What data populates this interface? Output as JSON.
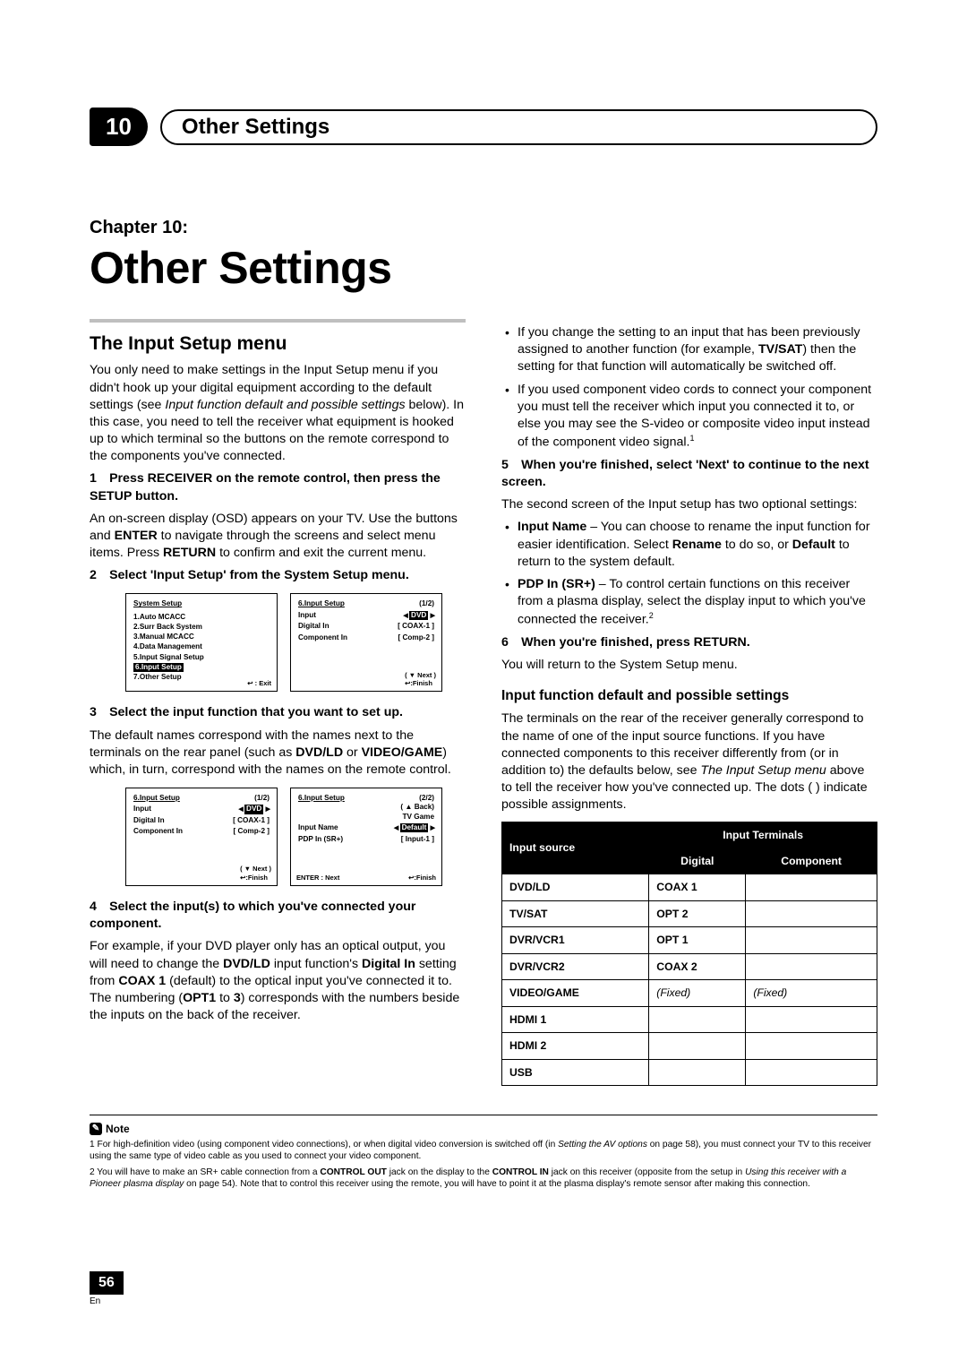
{
  "header": {
    "chapter_num": "10",
    "tab_title": "Other Settings",
    "chapter_label": "Chapter 10:",
    "page_title": "Other Settings"
  },
  "left": {
    "sec1_title": "The Input Setup menu",
    "sec1_p1a": "You only need to make settings in the Input Setup menu if you didn't hook up your digital equipment according to the default settings (see ",
    "sec1_p1b_it": "Input function default and possible settings",
    "sec1_p1c": " below). In this case, you need to tell the receiver what equipment is hooked up to which terminal so the buttons on the remote correspond to the components you've connected.",
    "step1_title": "1 Press RECEIVER on the remote control, then press the SETUP button.",
    "step1_p1a": "An on-screen display (OSD) appears on your TV. Use the ",
    "step1_p1b": " buttons and ",
    "step1_p1c_b": "ENTER",
    "step1_p1d": " to navigate through the screens and select menu items. Press ",
    "step1_p1e_b": "RETURN",
    "step1_p1f": " to confirm and exit the current menu.",
    "step2_title": "2 Select 'Input Setup' from the System Setup menu.",
    "osdA": {
      "title": "System  Setup",
      "items": [
        "1.Auto  MCACC",
        "2.Surr  Back  System",
        "3.Manual  MCACC",
        "4.Data  Management",
        "5.Input  Signal  Setup"
      ],
      "hl": "6.Input  Setup",
      "after": "7.Other  Setup",
      "foot_icon": "↩",
      "foot": " :  Exit"
    },
    "osdB": {
      "title": "6.Input  Setup",
      "count": "(1/2)",
      "row1_l": "Input",
      "row1_r": "DVD",
      "row2_l": "Digital  In",
      "row2_r": "[  COAX-1   ]",
      "row3_l": "Component In",
      "row3_r": "[  Comp-2   ]",
      "foot_center": "( ▼ Next )",
      "foot_r": "↩:Finish"
    },
    "step3_title": "3 Select the input function that you want to set up.",
    "step3_p1a": "The default names correspond with the names next to the terminals on the rear panel (such as ",
    "step3_p1b_b": "DVD/LD",
    "step3_p1c": " or ",
    "step3_p1d_b": "VIDEO/GAME",
    "step3_p1e": ") which, in turn, correspond with the names on the remote control.",
    "osdC": {
      "title": "6.Input  Setup",
      "count": "(1/2)",
      "row1_l": "Input",
      "row1_r": "DVD",
      "row2_l": "Digital  In",
      "row2_r": "[  COAX-1   ]",
      "row3_l": "Component In",
      "row3_r": "[  Comp-2   ]",
      "foot_center": "( ▼ Next )",
      "foot_r": "↩:Finish"
    },
    "osdD": {
      "title": "6.Input  Setup",
      "count": "(2/2)",
      "back": "( ▲ Back)",
      "row0": "TV Game",
      "row1_l": "Input  Name",
      "row1_r": "Default",
      "row2_l": "PDP  In  (SR+)",
      "row2_r": "[   Input-1   ]",
      "foot_l": "ENTER : Next",
      "foot_r": "↩:Finish"
    },
    "step4_title": "4 Select the input(s) to which you've connected your component.",
    "step4_p1a": "For example, if your DVD player only has an optical output, you will need to change the ",
    "step4_p1b_b": "DVD/LD",
    "step4_p1c": " input function's ",
    "step4_p1d_b": "Digital In",
    "step4_p1e": " setting from ",
    "step4_p1f_b": "COAX 1",
    "step4_p1g": " (default) to the optical input you've connected it to. The numbering (",
    "step4_p1h_b": "OPT1",
    "step4_p1i": " to ",
    "step4_p1j_b": "3",
    "step4_p1k": ") corresponds with the numbers beside the inputs on the back of the receiver."
  },
  "right": {
    "b1a": "If you change the setting to an input that has been previously assigned to another function (for example, ",
    "b1b_b": "TV/SAT",
    "b1c": ") then the setting for that function will automatically be switched off.",
    "b2": "If you used component video cords to connect your component you must tell the receiver which input you connected it to, or else you may see the S-video or composite video input instead of the component video signal.",
    "b2_sup": "1",
    "step5_title": "5 When you're finished, select 'Next' to continue to the next screen.",
    "step5_p1": "The second screen of the Input setup has two optional settings:",
    "b3a_b": "Input Name",
    "b3a": " – You can choose to rename the input function for easier identification. Select ",
    "b3b_b": "Rename",
    "b3c": " to do so, or ",
    "b3d_b": "Default",
    "b3e": " to return to the system default.",
    "b4a_b": "PDP In (SR+)",
    "b4a": " – To control certain functions on this receiver from a plasma display, select the display input to which you've connected the receiver.",
    "b4_sup": "2",
    "step6_title": "6 When you're finished, press RETURN.",
    "step6_p1": "You will return to the System Setup menu.",
    "h3": "Input function default and possible settings",
    "h3_p1a": "The terminals on the rear of the receiver generally correspond to the name of one of the input source functions. If you have connected components to this receiver differently from (or in addition to) the defaults below, see ",
    "h3_p1b_it": "The Input Setup menu",
    "h3_p1c": " above to tell the receiver how you've connected up. The dots (   ) indicate possible assignments.",
    "table": {
      "head_src": "Input source",
      "head_terms": "Input Terminals",
      "head_dig": "Digital",
      "head_comp": "Component",
      "rows": [
        {
          "src": "DVD/LD",
          "dig": "COAX 1",
          "comp": ""
        },
        {
          "src": "TV/SAT",
          "dig": "OPT 2",
          "comp": ""
        },
        {
          "src": "DVR/VCR1",
          "dig": "OPT 1",
          "comp": ""
        },
        {
          "src": "DVR/VCR2",
          "dig": "COAX 2",
          "comp": ""
        },
        {
          "src": "VIDEO/GAME",
          "dig": "(Fixed)",
          "comp": "(Fixed)",
          "italic": true
        },
        {
          "src": "HDMI 1",
          "dig": "",
          "comp": ""
        },
        {
          "src": "HDMI 2",
          "dig": "",
          "comp": ""
        },
        {
          "src": "USB",
          "dig": "",
          "comp": ""
        }
      ]
    }
  },
  "footnotes": {
    "tag": "Note",
    "f1a": "1  For high-definition video (using component video connections), or when digital video conversion is switched off (in ",
    "f1b_it": "Setting the AV options",
    "f1c": " on page 58), you must connect your TV to this receiver using the same type of video cable as you used to connect your video component.",
    "f2a": "2  You will have to make an SR+ cable connection from a ",
    "f2b_b": "CONTROL OUT",
    "f2c": " jack on the display to the ",
    "f2d_b": "CONTROL IN",
    "f2e": " jack on this receiver (opposite from the setup in ",
    "f2f_it": "Using this receiver with a Pioneer plasma display",
    "f2g": " on page 54). Note that to control this receiver using the remote, you will have to point it at the plasma display's remote sensor after making this connection."
  },
  "pager": {
    "num": "56",
    "lang": "En"
  }
}
